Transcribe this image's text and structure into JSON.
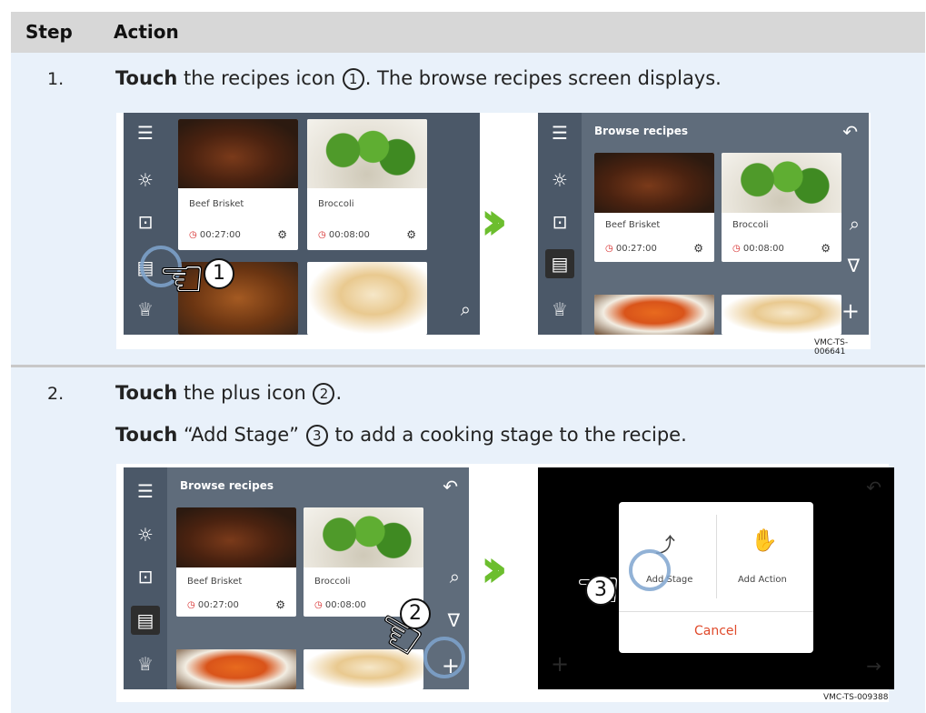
{
  "header": {
    "step": "Step",
    "action": "Action"
  },
  "steps": [
    {
      "num": "1.",
      "lines": [
        {
          "bold": "Touch",
          "pre": "the recipes icon",
          "circ": "1",
          "post": ". The browse recipes screen displays."
        }
      ],
      "ref": "VMC-TS-006641"
    },
    {
      "num": "2.",
      "lines": [
        {
          "bold": "Touch",
          "pre": "the plus icon",
          "circ": "2",
          "post": "."
        },
        {
          "bold": "Touch",
          "pre": "“Add Stage”",
          "circ": "3",
          "post": "to add a cooking stage to the recipe."
        }
      ],
      "ref": "VMC-TS-009388"
    }
  ],
  "screens": {
    "browse_title": "Browse recipes",
    "cards": [
      {
        "name": "Beef Brisket",
        "time": "00:27:00"
      },
      {
        "name": "Broccoli",
        "time": "00:08:00"
      }
    ]
  },
  "callouts": [
    "1",
    "2",
    "3"
  ],
  "dialog": {
    "add_stage": "Add Stage",
    "add_action": "Add Action",
    "cancel": "Cancel"
  },
  "colors": {
    "header_bg": "#d7d7d7",
    "row_bg": "#e9f1fa",
    "sidebar": "#4b5868",
    "accent_green": "#6cbe2e",
    "cancel_red": "#e04a2b"
  },
  "icons": [
    "menu-icon",
    "sun-icon",
    "lock-icon",
    "recipe-book-icon",
    "chef-hat-icon",
    "undo-icon",
    "search-icon",
    "filter-icon",
    "plus-icon",
    "clock-icon",
    "gear-icon",
    "hand-pointer-icon",
    "chevron-right-icon"
  ]
}
